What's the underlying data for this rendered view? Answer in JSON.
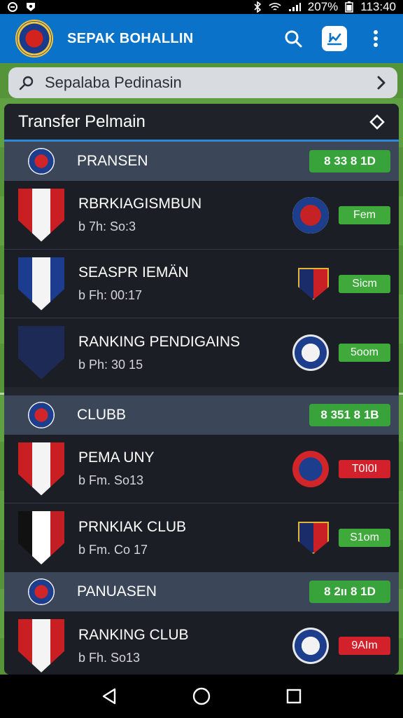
{
  "status_bar": {
    "battery": "207%",
    "time": "113:40"
  },
  "app_bar": {
    "title": "SEPAK BOHALLIN",
    "icons": [
      "search-icon",
      "chart-icon",
      "more-vert-icon"
    ]
  },
  "search": {
    "placeholder": "Sepalaba Pedinasin",
    "icon": "pen-icon",
    "trailing_icon": "chevron-right-icon"
  },
  "panel": {
    "title": "Transfer Pelmain",
    "icon": "diamond-icon"
  },
  "groups": [
    {
      "name": "PRANSEN",
      "pill": "8 33 8 1D",
      "rows": [
        {
          "name": "RBRKIAGISMBUN",
          "meta": "b 7h: So:3",
          "fee": "Fem",
          "fee_color": "green"
        },
        {
          "name": "SEASPR IEMÄN",
          "meta": "b Fh: 00:17",
          "fee": "Sicm",
          "fee_color": "green"
        },
        {
          "name": "RANKING PENDIGAINS",
          "meta": "b Ph: 30 15",
          "fee": "5oom",
          "fee_color": "green"
        }
      ]
    },
    {
      "name": "CLUBB",
      "pill": "8 351 8 1B",
      "rows": [
        {
          "name": "PEMA UNY",
          "meta": "b Fm. So13",
          "fee": "T0I0I",
          "fee_color": "red"
        },
        {
          "name": "PRNKIAK CLUB",
          "meta": "b Fm. Co 17",
          "fee": "S1om",
          "fee_color": "green"
        }
      ]
    },
    {
      "name": "PANUASEN",
      "pill": "8 2ıı 8 1D",
      "rows": [
        {
          "name": "RANKING CLUB",
          "meta": "b Fh. So13",
          "fee": "9AIm",
          "fee_color": "red"
        }
      ]
    }
  ],
  "nav": {
    "icons": [
      "back-icon",
      "home-icon",
      "recents-icon"
    ]
  }
}
